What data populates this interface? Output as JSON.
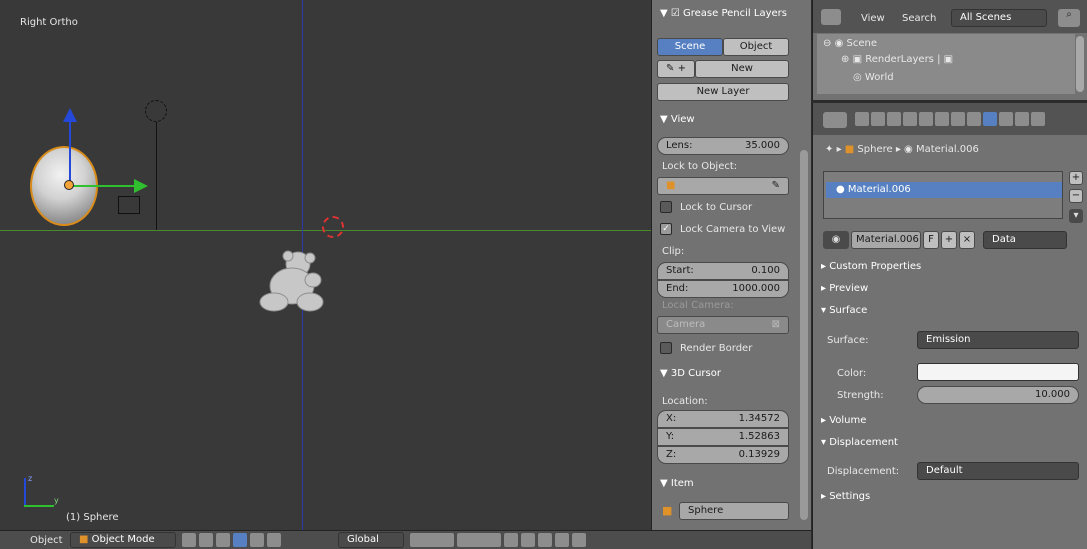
{
  "viewport": {
    "title": "Right Ortho",
    "object_label": "(1) Sphere",
    "axis_z": "z",
    "axis_y": "y"
  },
  "npanel": {
    "grease_pencil": "Grease Pencil Layers",
    "scene_tab": "Scene",
    "object_tab": "Object",
    "new_btn": "New",
    "new_layer_btn": "New Layer",
    "view_header": "View",
    "lens_label": "Lens:",
    "lens_value": "35.000",
    "lock_to_object": "Lock to Object:",
    "lock_to_cursor": "Lock to Cursor",
    "lock_camera": "Lock Camera to View",
    "clip": "Clip:",
    "start_label": "Start:",
    "start_value": "0.100",
    "end_label": "End:",
    "end_value": "1000.000",
    "local_camera": "Local Camera:",
    "camera": "Camera",
    "render_border": "Render Border",
    "cursor_header": "3D Cursor",
    "location": "Location:",
    "x_label": "X:",
    "x_value": "1.34572",
    "y_label": "Y:",
    "y_value": "1.52863",
    "z_label": "Z:",
    "z_value": "0.13929",
    "item_header": "Item",
    "item_name": "Sphere"
  },
  "outliner": {
    "view": "View",
    "search": "Search",
    "scenes": "All Scenes",
    "scene": "Scene",
    "renderlayers": "RenderLayers",
    "world": "World"
  },
  "props": {
    "crumb_obj": "Sphere",
    "crumb_mat": "Material.006",
    "mat_slot": "Material.006",
    "mat_name": "Material.006",
    "mat_f": "F",
    "data_dropdown": "Data",
    "custom_props": "Custom Properties",
    "preview": "Preview",
    "surface": "Surface",
    "surface_label": "Surface:",
    "surface_value": "Emission",
    "color_label": "Color:",
    "strength_label": "Strength:",
    "strength_value": "10.000",
    "volume": "Volume",
    "displacement": "Displacement",
    "displacement_label": "Displacement:",
    "displacement_value": "Default",
    "settings": "Settings"
  },
  "bottombar": {
    "object_menu": "Object",
    "mode": "Object Mode",
    "orientation": "Global"
  }
}
